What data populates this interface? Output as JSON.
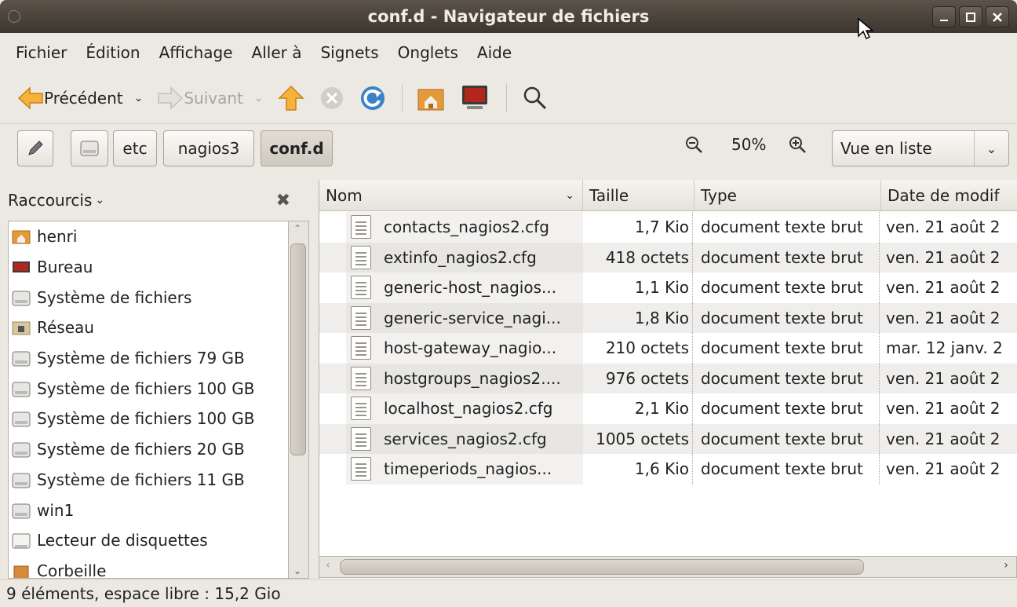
{
  "window": {
    "title": "conf.d - Navigateur de fichiers"
  },
  "menu": [
    {
      "label": "Fichier",
      "accel": "F"
    },
    {
      "label": "Édition",
      "accel": "É"
    },
    {
      "label": "Affichage",
      "accel": "A"
    },
    {
      "label": "Aller à",
      "accel": "e"
    },
    {
      "label": "Signets",
      "accel": "S"
    },
    {
      "label": "Onglets",
      "accel": "O"
    },
    {
      "label": "Aide",
      "accel": "e"
    }
  ],
  "toolbar": {
    "back_label": "Précédent",
    "forward_label": "Suivant"
  },
  "path": {
    "segments": [
      "etc",
      "nagios3",
      "conf.d"
    ]
  },
  "zoom": {
    "level": "50%"
  },
  "view": {
    "selected": "Vue en liste"
  },
  "sidebar": {
    "title": "Raccourcis",
    "items": [
      {
        "label": "henri",
        "icon": "home-folder-icon"
      },
      {
        "label": "Bureau",
        "icon": "desktop-icon"
      },
      {
        "label": "Système de fichiers",
        "icon": "drive-icon"
      },
      {
        "label": "Réseau",
        "icon": "network-folder-icon"
      },
      {
        "label": "Système de fichiers 79 GB",
        "icon": "drive-icon"
      },
      {
        "label": "Système de fichiers 100 GB",
        "icon": "drive-icon"
      },
      {
        "label": "Système de fichiers 100 GB",
        "icon": "drive-icon"
      },
      {
        "label": "Système de fichiers 20 GB",
        "icon": "drive-icon"
      },
      {
        "label": "Système de fichiers 11 GB",
        "icon": "drive-icon"
      },
      {
        "label": "win1",
        "icon": "drive-icon"
      },
      {
        "label": "Lecteur de disquettes",
        "icon": "floppy-icon"
      },
      {
        "label": "Corbeille",
        "icon": "trash-icon"
      }
    ]
  },
  "columns": {
    "name": "Nom",
    "size": "Taille",
    "type": "Type",
    "date": "Date de modif"
  },
  "files": [
    {
      "name": "contacts_nagios2.cfg",
      "size": "1,7 Kio",
      "type": "document texte brut",
      "date": "ven. 21 août 2"
    },
    {
      "name": "extinfo_nagios2.cfg",
      "size": "418 octets",
      "type": "document texte brut",
      "date": "ven. 21 août 2"
    },
    {
      "name": "generic-host_nagios...",
      "size": "1,1 Kio",
      "type": "document texte brut",
      "date": "ven. 21 août 2"
    },
    {
      "name": "generic-service_nagi...",
      "size": "1,8 Kio",
      "type": "document texte brut",
      "date": "ven. 21 août 2"
    },
    {
      "name": "host-gateway_nagio...",
      "size": "210 octets",
      "type": "document texte brut",
      "date": "mar. 12 janv. 2"
    },
    {
      "name": "hostgroups_nagios2....",
      "size": "976 octets",
      "type": "document texte brut",
      "date": "ven. 21 août 2"
    },
    {
      "name": "localhost_nagios2.cfg",
      "size": "2,1 Kio",
      "type": "document texte brut",
      "date": "ven. 21 août 2"
    },
    {
      "name": "services_nagios2.cfg",
      "size": "1005 octets",
      "type": "document texte brut",
      "date": "ven. 21 août 2"
    },
    {
      "name": "timeperiods_nagios...",
      "size": "1,6 Kio",
      "type": "document texte brut",
      "date": "ven. 21 août 2"
    }
  ],
  "status": {
    "text": "9 éléments, espace libre : 15,2 Gio"
  }
}
